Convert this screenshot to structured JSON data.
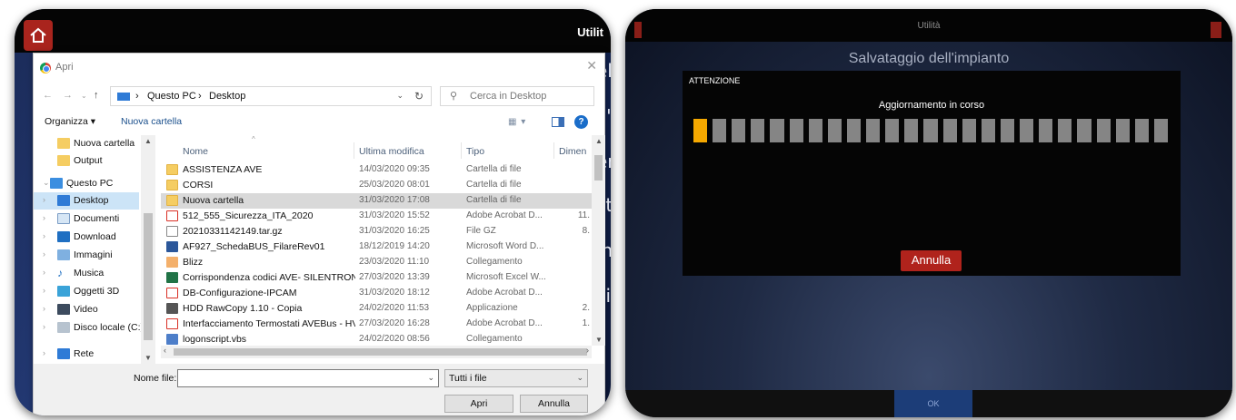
{
  "left_app": {
    "top_right_title": "Utilit",
    "background_texts": [
      "ell",
      "ll'i",
      "en",
      "st",
      "in",
      "zi"
    ]
  },
  "file_dialog": {
    "title": "Apri",
    "breadcrumb": [
      "Questo PC",
      "Desktop"
    ],
    "search_placeholder": "Cerca in Desktop",
    "toolbar": {
      "organize": "Organizza ▾",
      "new_folder": "Nuova cartella"
    },
    "nav_items": [
      {
        "label": "Nuova cartella",
        "icon": "folder-icon",
        "selected": false
      },
      {
        "label": "Output",
        "icon": "folder-icon",
        "selected": false
      },
      {
        "label": "Questo PC",
        "icon": "computer-icon",
        "selected": false
      },
      {
        "label": "Desktop",
        "icon": "desktop-icon",
        "selected": true
      },
      {
        "label": "Documenti",
        "icon": "documents-icon",
        "selected": false
      },
      {
        "label": "Download",
        "icon": "download-icon",
        "selected": false
      },
      {
        "label": "Immagini",
        "icon": "pictures-icon",
        "selected": false
      },
      {
        "label": "Musica",
        "icon": "music-icon",
        "selected": false
      },
      {
        "label": "Oggetti 3D",
        "icon": "3d-objects-icon",
        "selected": false
      },
      {
        "label": "Video",
        "icon": "video-icon",
        "selected": false
      },
      {
        "label": "Disco locale (C:)",
        "icon": "drive-icon",
        "selected": false
      },
      {
        "label": "Rete",
        "icon": "network-icon",
        "selected": false
      }
    ],
    "columns": {
      "name": "Nome",
      "modified": "Ultima modifica",
      "type": "Tipo",
      "size": "Dimen"
    },
    "files": [
      {
        "name": "ASSISTENZA AVE",
        "modified": "14/03/2020 09:35",
        "type": "Cartella di file",
        "size": "",
        "kind": "folder",
        "selected": false
      },
      {
        "name": "CORSI",
        "modified": "25/03/2020 08:01",
        "type": "Cartella di file",
        "size": "",
        "kind": "folder",
        "selected": false
      },
      {
        "name": "Nuova cartella",
        "modified": "31/03/2020 17:08",
        "type": "Cartella di file",
        "size": "",
        "kind": "folder",
        "selected": true
      },
      {
        "name": "512_555_Sicurezza_ITA_2020",
        "modified": "31/03/2020 15:52",
        "type": "Adobe Acrobat D...",
        "size": "11.",
        "kind": "pdf",
        "selected": false
      },
      {
        "name": "20210331142149.tar.gz",
        "modified": "31/03/2020 16:25",
        "type": "File GZ",
        "size": "8.",
        "kind": "gz",
        "selected": false
      },
      {
        "name": "AF927_SchedaBUS_FilareRev01",
        "modified": "18/12/2019 14:20",
        "type": "Microsoft Word D...",
        "size": "",
        "kind": "word",
        "selected": false
      },
      {
        "name": "Blizz",
        "modified": "23/03/2020 11:10",
        "type": "Collegamento",
        "size": "",
        "kind": "link",
        "selected": false
      },
      {
        "name": "Corrispondenza codici AVE- SILENTRON",
        "modified": "27/03/2020 13:39",
        "type": "Microsoft Excel W...",
        "size": "",
        "kind": "excel",
        "selected": false
      },
      {
        "name": "DB-Configurazione-IPCAM",
        "modified": "31/03/2020 18:12",
        "type": "Adobe Acrobat D...",
        "size": "",
        "kind": "pdf",
        "selected": false
      },
      {
        "name": "HDD RawCopy 1.10 - Copia",
        "modified": "24/02/2020 11:53",
        "type": "Applicazione",
        "size": "2.",
        "kind": "app",
        "selected": false
      },
      {
        "name": "Interfacciamento Termostati AVEBus - HV...",
        "modified": "27/03/2020 16:28",
        "type": "Adobe Acrobat D...",
        "size": "1.",
        "kind": "pdf",
        "selected": false
      },
      {
        "name": "logonscript.vbs",
        "modified": "24/02/2020 08:56",
        "type": "Collegamento",
        "size": "",
        "kind": "vbs",
        "selected": false
      }
    ],
    "filename_label": "Nome file:",
    "filename_value": "",
    "filter": "Tutti i file",
    "open_button": "Apri",
    "cancel_button": "Annulla"
  },
  "right_app": {
    "top_title": "Utilità",
    "heading": "Salvataggio dell'impianto",
    "modal_title": "ATTENZIONE",
    "modal_message": "Aggiornamento in corso",
    "progress": {
      "segments_total": 25,
      "segments_done": 1,
      "done_color": "#f5a800",
      "pending_color": "#858585"
    },
    "cancel_button": "Annulla",
    "ok_button": "OK"
  },
  "colors": {
    "brand_red": "#b0231c",
    "selection_blue": "#cce4f7",
    "link_blue": "#1a4f8c"
  }
}
